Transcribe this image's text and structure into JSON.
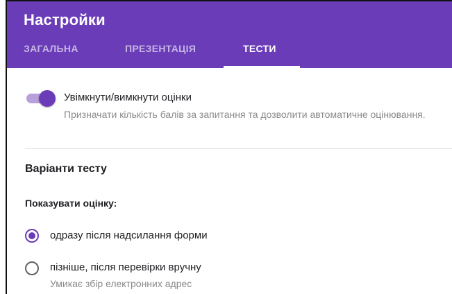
{
  "header": {
    "title": "Настройки",
    "tabs": [
      {
        "label": "ЗАГАЛЬНА",
        "active": false
      },
      {
        "label": "ПРЕЗЕНТАЦІЯ",
        "active": false
      },
      {
        "label": "ТЕСТИ",
        "active": true
      }
    ]
  },
  "grading": {
    "toggle_on": true,
    "label": "Увімкнути/вимкнути оцінки",
    "description": "Призначати кількість балів за запитання та дозволити автоматичне оцінювання."
  },
  "quiz_options": {
    "section_title": "Варіанти тесту",
    "show_grade_label": "Показувати оцінку:",
    "options": [
      {
        "label": "одразу після надсилання форми",
        "selected": true,
        "sub": ""
      },
      {
        "label": "пізніше, після перевірки вручну",
        "selected": false,
        "sub": "Умикає збір електронних адрес"
      }
    ]
  },
  "colors": {
    "accent": "#6a3cb8",
    "toggle_track": "#b7a0dc",
    "secondary_text": "#8a8a8a"
  }
}
